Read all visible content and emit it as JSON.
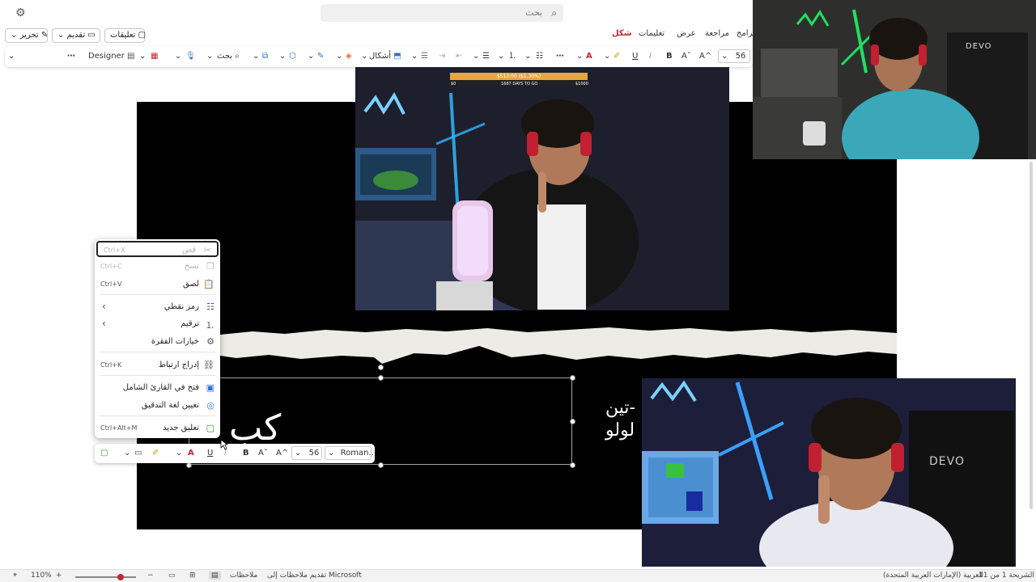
{
  "search": {
    "placeholder": "بحث"
  },
  "tabs": {
    "edit_label": "تحرير",
    "present_label": "تقديم",
    "comments_label": "تعليقات",
    "shape": "شكل",
    "help": "تعليمات",
    "view": "عرض",
    "review": "مراجعة",
    "programs": "برامج"
  },
  "ribbon": {
    "designer": "Designer",
    "search_label": "بحث",
    "shapes_label": "أشكال",
    "font_size": "56",
    "bold": "B",
    "italic": "I",
    "underline": "U",
    "grow": "A^",
    "shrink": "Aˇ"
  },
  "context_menu": {
    "items": [
      {
        "label": "قص",
        "shortcut": "Ctrl+X",
        "icon": "scissors-icon",
        "disabled": true
      },
      {
        "label": "نسخ",
        "shortcut": "Ctrl+C",
        "icon": "copy-icon",
        "disabled": true
      },
      {
        "label": "لصق",
        "shortcut": "Ctrl+V",
        "icon": "paste-icon",
        "disabled": false
      },
      {
        "label": "رمز نقطي",
        "shortcut": "",
        "icon": "bullets-icon",
        "submenu": true
      },
      {
        "label": "ترقيم",
        "shortcut": "",
        "icon": "numbering-icon",
        "submenu": true
      },
      {
        "label": "خيارات الفقرة",
        "shortcut": "",
        "icon": "gear-icon"
      },
      {
        "label": "إدراج ارتباط",
        "shortcut": "Ctrl+K",
        "icon": "link-icon"
      },
      {
        "label": "فتح في القارئ الشامل",
        "shortcut": "",
        "icon": "reader-icon"
      },
      {
        "label": "تعيين لغة التدقيق",
        "shortcut": "",
        "icon": "language-icon"
      },
      {
        "label": "تعليق جديد",
        "shortcut": "Ctrl+Alt+M",
        "icon": "comment-icon"
      }
    ]
  },
  "mini_toolbar": {
    "font_name": "Roman...",
    "font_size": "56",
    "bold": "B",
    "italic": "I",
    "underline": "U"
  },
  "slide": {
    "text_left": "كب",
    "text_right_1": "تين-",
    "text_right_2": "لولو"
  },
  "stream_overlay": {
    "goal_text": "$513.00 ($1.30%)",
    "goal_left": "$0",
    "goal_mid": "1687 DAYS TO GO",
    "goal_right": "$1000",
    "brand": "DEVO"
  },
  "statusbar": {
    "slide_info": "الشريحة 1 من 11",
    "language": "العربية (الإمارات العربية المتحدة)",
    "feedback": "تقديم ملاحظات إلى Microsoft",
    "notes": "ملاحظات",
    "zoom": "110%",
    "zoom_fraction": 0.75
  },
  "colors": {
    "accent": "#c4262e",
    "slide_bg": "#000000",
    "neon_blue": "#3aa0ff",
    "neon_green": "#20e060"
  }
}
